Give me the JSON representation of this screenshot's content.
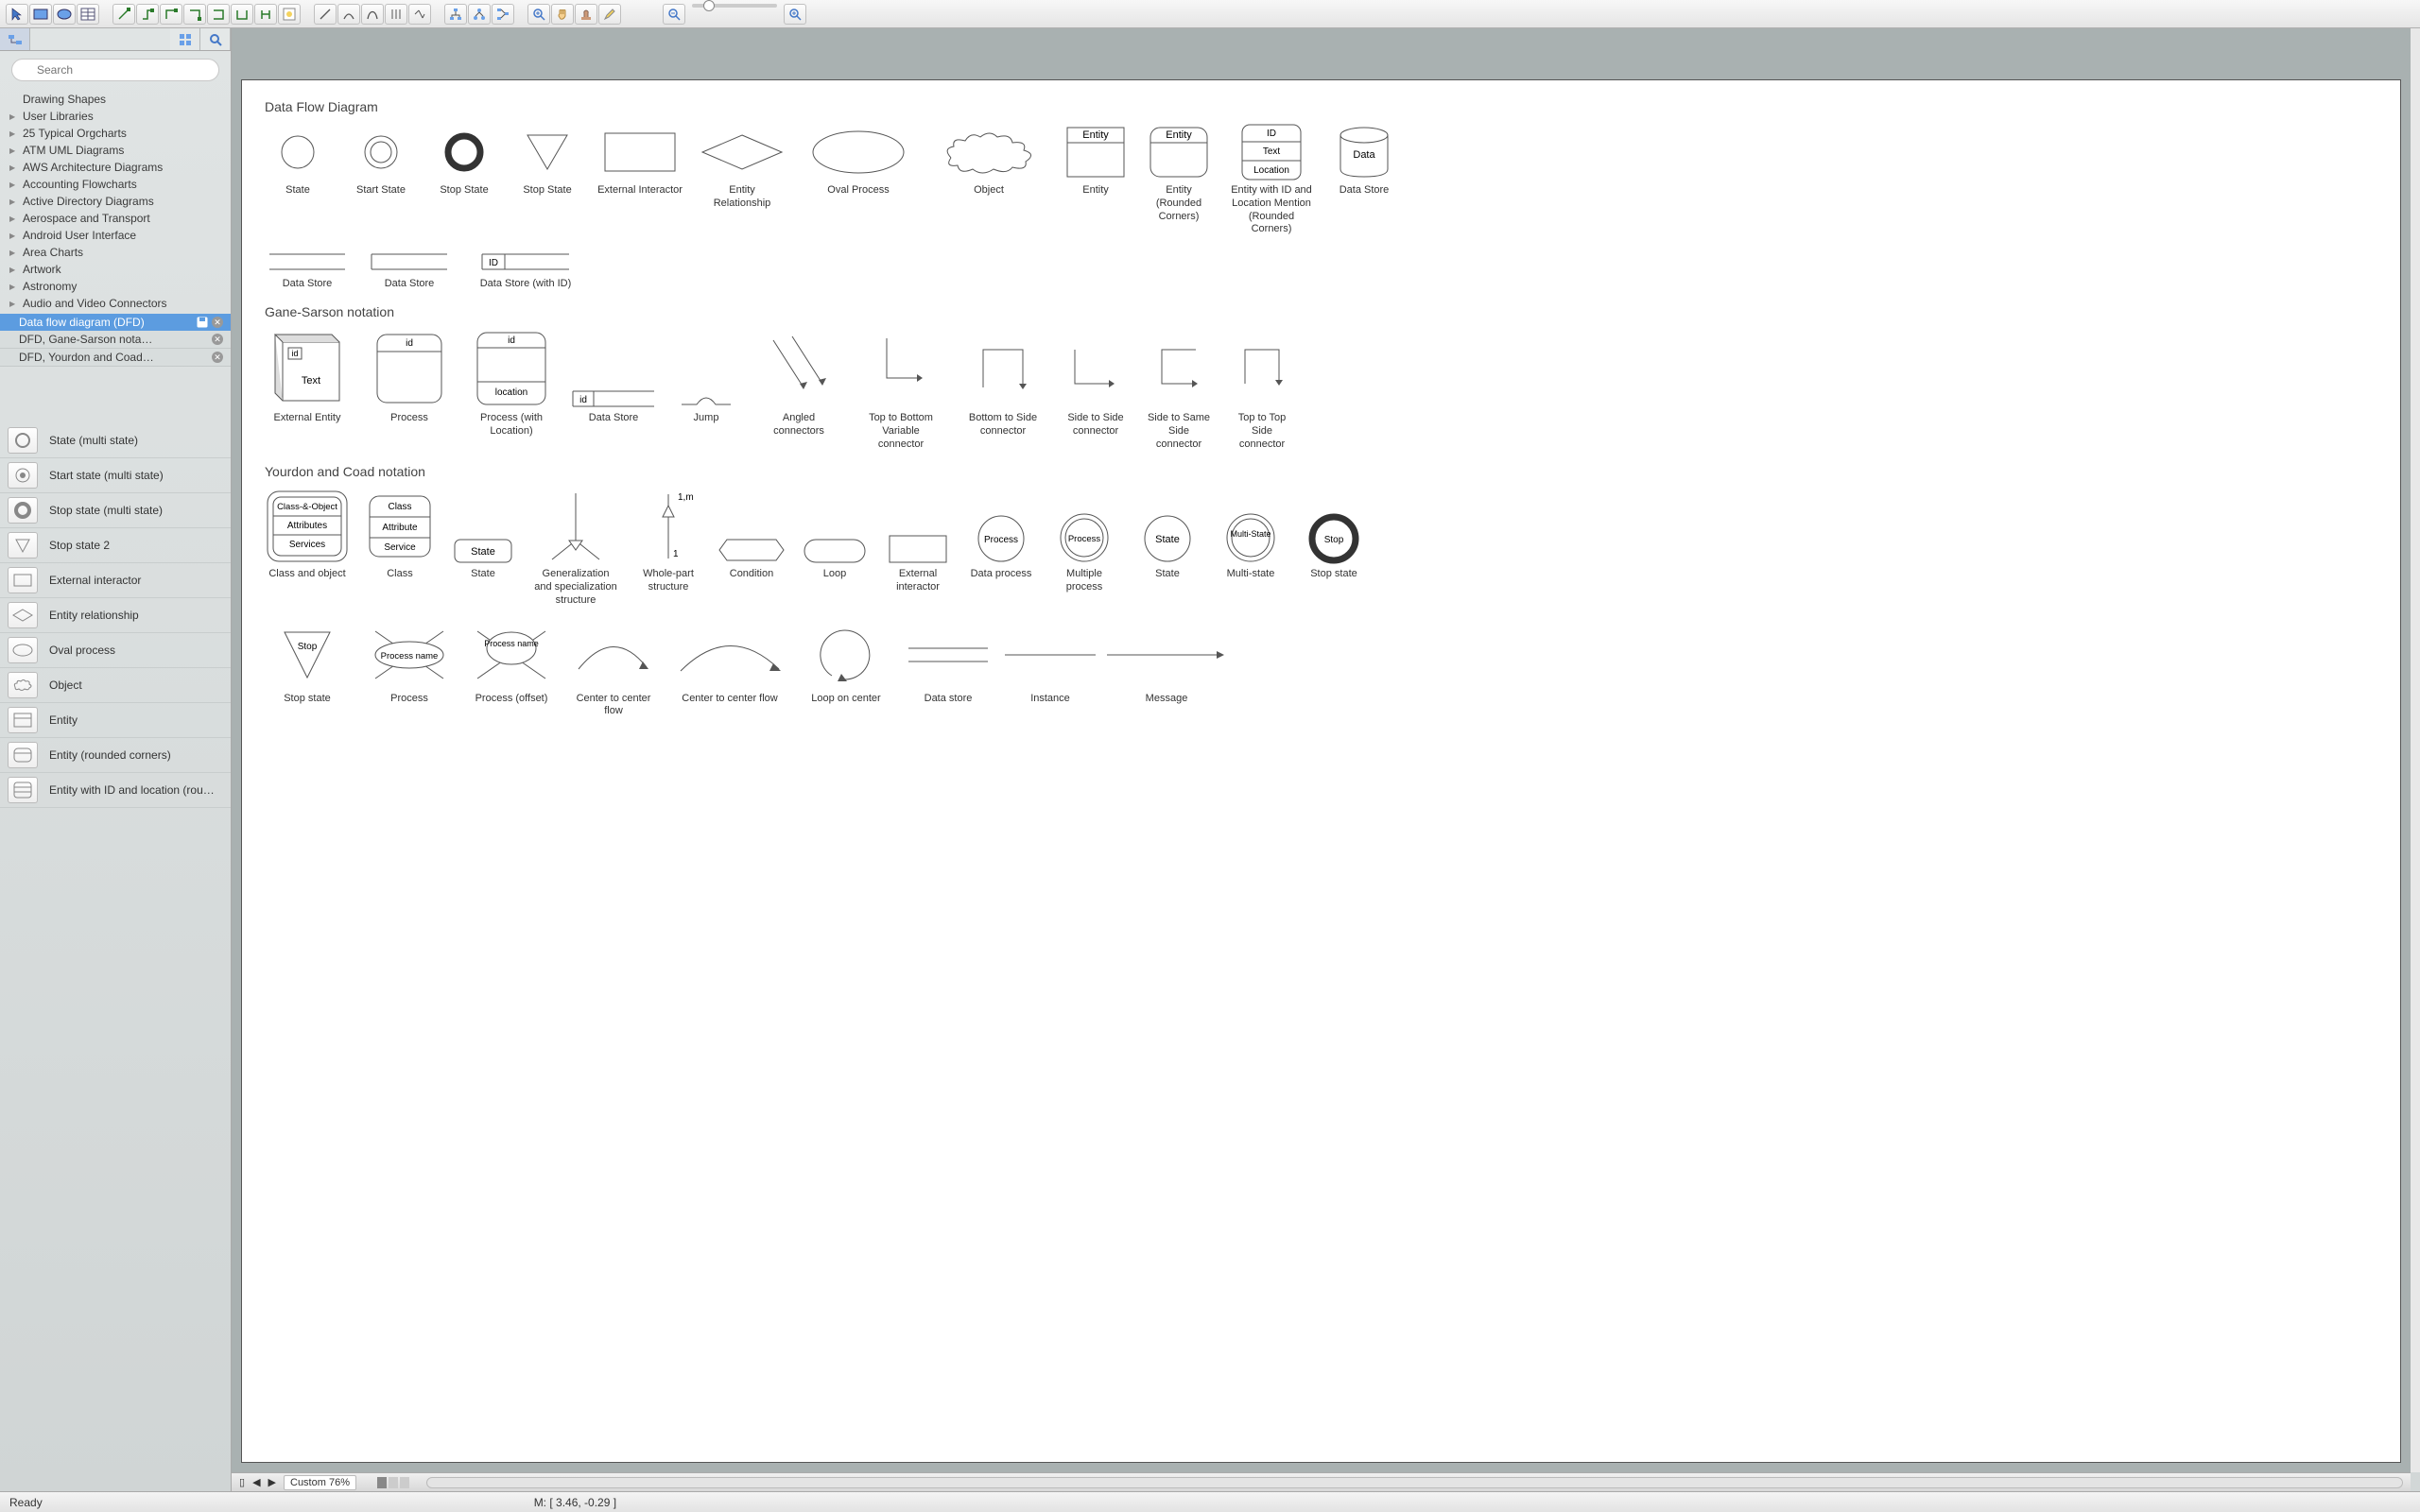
{
  "search": {
    "placeholder": "Search"
  },
  "zoom_label": "Custom 76%",
  "status": {
    "ready": "Ready",
    "mouse": "M: [ 3.46, -0.29 ]"
  },
  "tree": [
    "Drawing Shapes",
    "User Libraries",
    "25 Typical Orgcharts",
    "ATM UML Diagrams",
    "AWS Architecture Diagrams",
    "Accounting Flowcharts",
    "Active Directory Diagrams",
    "Aerospace and Transport",
    "Android User Interface",
    "Area Charts",
    "Artwork",
    "Astronomy",
    "Audio and Video Connectors"
  ],
  "open_libs": {
    "active": "Data flow diagram (DFD)",
    "others": [
      "DFD, Gane-Sarson nota…",
      "DFD, Yourdon and Coad…"
    ]
  },
  "stencils": [
    "State (multi state)",
    "Start state (multi state)",
    "Stop state (multi state)",
    "Stop state 2",
    "External interactor",
    "Entity relationship",
    "Oval process",
    "Object",
    "Entity",
    "Entity (rounded corners)",
    "Entity with ID and location (rou…"
  ],
  "sections": {
    "dfd": {
      "title": "Data Flow Diagram",
      "row1": [
        "State",
        "Start State",
        "Stop State",
        "Stop State",
        "External Interactor",
        "Entity Relationship",
        "Oval Process",
        "Object",
        "Entity",
        "Entity (Rounded Corners)",
        "Entity with ID and Location Mention (Rounded Corners)",
        "Data Store"
      ],
      "row1_inner": {
        "entity1": "Entity",
        "entity2": "Entity",
        "idtext": "ID",
        "text": "Text",
        "loc": "Location",
        "data": "Data"
      },
      "row2": [
        "Data Store",
        "Data Store",
        "Data Store (with ID)"
      ],
      "row2_inner": {
        "id": "ID"
      }
    },
    "gane": {
      "title": "Gane-Sarson notation",
      "labels": [
        "External Entity",
        "Process",
        "Process (with Location)",
        "Data Store",
        "Jump",
        "Angled connectors",
        "Top to Bottom Variable connector",
        "Bottom to Side connector",
        "Side to Side connector",
        "Side to Same Side connector",
        "Top to Top Side connector"
      ],
      "inner": {
        "id": "id",
        "text": "Text",
        "location": "location"
      }
    },
    "yourdon": {
      "title": "Yourdon and Coad notation",
      "row1_labels": [
        "Class and object",
        "Class",
        "State",
        "Generalization and specialization structure",
        "Whole-part structure",
        "Condition",
        "Loop",
        "External interactor",
        "Data process",
        "Multiple process",
        "State",
        "Multi-state",
        "Stop state"
      ],
      "row1_inner": {
        "cao": "Class-&-Object",
        "attrs": "Attributes",
        "services": "Services",
        "class": "Class",
        "attribute": "Attribute",
        "service": "Service",
        "state": "State",
        "one_m": "1,m",
        "one": "1",
        "process": "Process",
        "multi": "Multi-State",
        "stop": "Stop"
      },
      "row2_labels": [
        "Stop state",
        "Process",
        "Process (offset)",
        "Center to center flow",
        "Center to center flow",
        "Loop on center",
        "Data store",
        "Instance",
        "Message"
      ],
      "row2_inner": {
        "stop": "Stop",
        "pname": "Process name",
        "pname2": "Process name"
      }
    }
  }
}
